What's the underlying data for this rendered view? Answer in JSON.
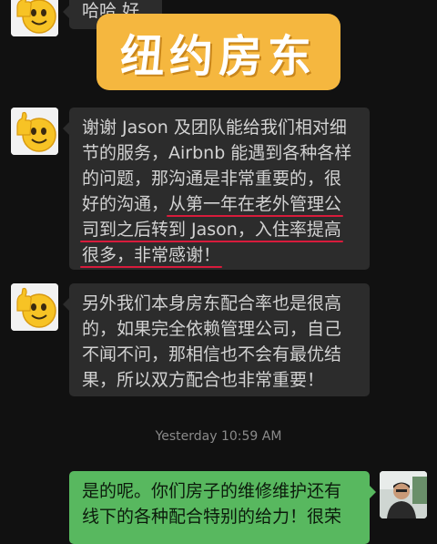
{
  "banner": {
    "title": "纽约房东"
  },
  "messages": [
    {
      "lines": [
        "哈哈 好"
      ]
    },
    {
      "lines": [
        "谢谢 Jason 及团队能给我们相对细",
        "节的服务，Airbnb 能遇到各种各样",
        "的问题，那沟通是非常重要的，很"
      ],
      "line4_plain": "好的沟通，",
      "line4_underlined": "从第一年在老外管理公",
      "line5": "司到之后转到 Jason，入住率提高",
      "line6": "很多，非常感谢！"
    },
    {
      "lines": [
        "另外我们本身房东配合率也是很高",
        "的，如果完全依赖管理公司，自己",
        "不闻不问，那相信也不会有最优结",
        "果，所以双方配合也非常重要！"
      ]
    }
  ],
  "timestamp": "Yesterday 10:59 AM",
  "reply": {
    "lines": [
      "是的呢。你们房子的维修维护还有",
      "线下的各种配合特别的给力！很荣"
    ]
  },
  "colors": {
    "background": "#111111",
    "incoming_bubble": "#2c2c2c",
    "outgoing_bubble": "#58b85f",
    "banner": "#f5b73f",
    "highlight_underline": "#d81b3c"
  },
  "icons": {
    "sender_avatar": "thumbs-up-emoji-avatar",
    "self_avatar": "photo-avatar"
  }
}
